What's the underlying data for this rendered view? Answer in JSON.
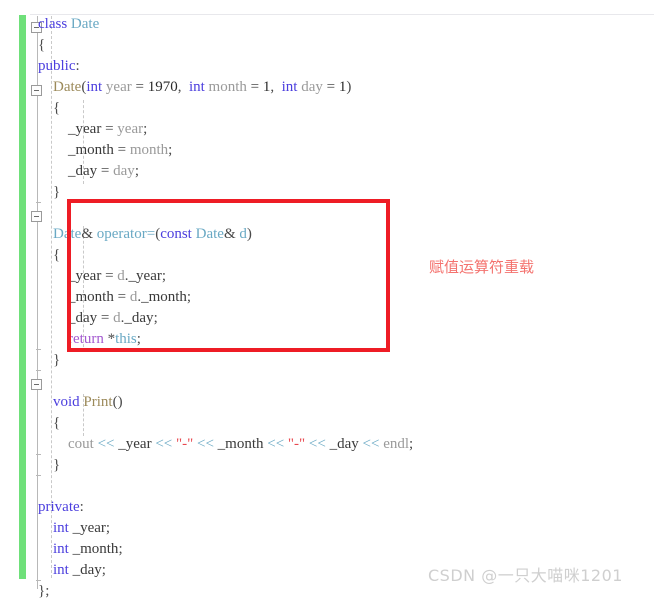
{
  "editor": {
    "language": "cpp",
    "gutter": {
      "change_bar_color": "#6fe07a",
      "fold_markers": [
        "collapse-class",
        "collapse-constructor",
        "collapse-operator",
        "collapse-print"
      ]
    },
    "theme": {
      "background": "#ffffff",
      "keyword_color": "#4b3ede",
      "type_color": "#6aa9c4",
      "function_color": "#9c8a5a",
      "identifier_color": "#3a3a3a",
      "parameter_color": "#9a9a9a",
      "string_color": "#e8484f",
      "return_color": "#a45ad0",
      "operator_color": "#6aa9c4"
    },
    "code_lines": [
      {
        "id": 1,
        "indent": 0,
        "tokens": [
          {
            "t": "class",
            "c": "kw"
          },
          {
            "t": " ",
            "c": "punct"
          },
          {
            "t": "Date",
            "c": "type"
          }
        ]
      },
      {
        "id": 2,
        "indent": 0,
        "tokens": [
          {
            "t": "{",
            "c": "punct"
          }
        ]
      },
      {
        "id": 3,
        "indent": 0,
        "tokens": [
          {
            "t": "public",
            "c": "kw"
          },
          {
            "t": ":",
            "c": "punct"
          }
        ]
      },
      {
        "id": 4,
        "indent": 1,
        "tokens": [
          {
            "t": "Date",
            "c": "fn"
          },
          {
            "t": "(",
            "c": "punct"
          },
          {
            "t": "int",
            "c": "kw"
          },
          {
            "t": " ",
            "c": "punct"
          },
          {
            "t": "year",
            "c": "param"
          },
          {
            "t": " = ",
            "c": "punct"
          },
          {
            "t": "1970",
            "c": "num"
          },
          {
            "t": ",  ",
            "c": "punct"
          },
          {
            "t": "int",
            "c": "kw"
          },
          {
            "t": " ",
            "c": "punct"
          },
          {
            "t": "month",
            "c": "param"
          },
          {
            "t": " = ",
            "c": "punct"
          },
          {
            "t": "1",
            "c": "num"
          },
          {
            "t": ",  ",
            "c": "punct"
          },
          {
            "t": "int",
            "c": "kw"
          },
          {
            "t": " ",
            "c": "punct"
          },
          {
            "t": "day",
            "c": "param"
          },
          {
            "t": " = ",
            "c": "punct"
          },
          {
            "t": "1",
            "c": "num"
          },
          {
            "t": ")",
            "c": "punct"
          }
        ]
      },
      {
        "id": 5,
        "indent": 1,
        "tokens": [
          {
            "t": "{",
            "c": "punct"
          }
        ]
      },
      {
        "id": 6,
        "indent": 2,
        "tokens": [
          {
            "t": "_year",
            "c": "ident"
          },
          {
            "t": " = ",
            "c": "punct"
          },
          {
            "t": "year",
            "c": "param"
          },
          {
            "t": ";",
            "c": "punct"
          }
        ]
      },
      {
        "id": 7,
        "indent": 2,
        "tokens": [
          {
            "t": "_month",
            "c": "ident"
          },
          {
            "t": " = ",
            "c": "punct"
          },
          {
            "t": "month",
            "c": "param"
          },
          {
            "t": ";",
            "c": "punct"
          }
        ]
      },
      {
        "id": 8,
        "indent": 2,
        "tokens": [
          {
            "t": "_day",
            "c": "ident"
          },
          {
            "t": " = ",
            "c": "punct"
          },
          {
            "t": "day",
            "c": "param"
          },
          {
            "t": ";",
            "c": "punct"
          }
        ]
      },
      {
        "id": 9,
        "indent": 1,
        "tokens": [
          {
            "t": "}",
            "c": "punct"
          }
        ]
      },
      {
        "id": 10,
        "indent": 0,
        "tokens": [
          {
            "t": "",
            "c": "punct"
          }
        ]
      },
      {
        "id": 11,
        "indent": 1,
        "tokens": [
          {
            "t": "Date",
            "c": "type"
          },
          {
            "t": "& ",
            "c": "punct"
          },
          {
            "t": "operator=",
            "c": "type"
          },
          {
            "t": "(",
            "c": "punct"
          },
          {
            "t": "const",
            "c": "kw"
          },
          {
            "t": " ",
            "c": "punct"
          },
          {
            "t": "Date",
            "c": "type"
          },
          {
            "t": "& ",
            "c": "punct"
          },
          {
            "t": "d",
            "c": "type"
          },
          {
            "t": ")",
            "c": "punct"
          }
        ]
      },
      {
        "id": 12,
        "indent": 1,
        "tokens": [
          {
            "t": "{",
            "c": "punct"
          }
        ]
      },
      {
        "id": 13,
        "indent": 2,
        "tokens": [
          {
            "t": "_year",
            "c": "ident"
          },
          {
            "t": " = ",
            "c": "punct"
          },
          {
            "t": "d",
            "c": "param"
          },
          {
            "t": ".",
            "c": "punct"
          },
          {
            "t": "_year",
            "c": "ident"
          },
          {
            "t": ";",
            "c": "punct"
          }
        ]
      },
      {
        "id": 14,
        "indent": 2,
        "tokens": [
          {
            "t": "_month",
            "c": "ident"
          },
          {
            "t": " = ",
            "c": "punct"
          },
          {
            "t": "d",
            "c": "param"
          },
          {
            "t": ".",
            "c": "punct"
          },
          {
            "t": "_month",
            "c": "ident"
          },
          {
            "t": ";",
            "c": "punct"
          }
        ]
      },
      {
        "id": 15,
        "indent": 2,
        "tokens": [
          {
            "t": "_day",
            "c": "ident"
          },
          {
            "t": " = ",
            "c": "punct"
          },
          {
            "t": "d",
            "c": "param"
          },
          {
            "t": ".",
            "c": "punct"
          },
          {
            "t": "_day",
            "c": "ident"
          },
          {
            "t": ";",
            "c": "punct"
          }
        ]
      },
      {
        "id": 16,
        "indent": 2,
        "tokens": [
          {
            "t": "return",
            "c": "ret"
          },
          {
            "t": " *",
            "c": "punct"
          },
          {
            "t": "this",
            "c": "type"
          },
          {
            "t": ";",
            "c": "punct"
          }
        ]
      },
      {
        "id": 17,
        "indent": 1,
        "tokens": [
          {
            "t": "}",
            "c": "punct"
          }
        ]
      },
      {
        "id": 18,
        "indent": 0,
        "tokens": [
          {
            "t": "",
            "c": "punct"
          }
        ]
      },
      {
        "id": 19,
        "indent": 1,
        "tokens": [
          {
            "t": "void",
            "c": "kw"
          },
          {
            "t": " ",
            "c": "punct"
          },
          {
            "t": "Print",
            "c": "fn"
          },
          {
            "t": "()",
            "c": "punct"
          }
        ]
      },
      {
        "id": 20,
        "indent": 1,
        "tokens": [
          {
            "t": "{",
            "c": "punct"
          }
        ]
      },
      {
        "id": 21,
        "indent": 2,
        "tokens": [
          {
            "t": "cout",
            "c": "param"
          },
          {
            "t": " ",
            "c": "punct"
          },
          {
            "t": "<<",
            "c": "op"
          },
          {
            "t": " ",
            "c": "punct"
          },
          {
            "t": "_year",
            "c": "ident"
          },
          {
            "t": " ",
            "c": "punct"
          },
          {
            "t": "<<",
            "c": "op"
          },
          {
            "t": " ",
            "c": "punct"
          },
          {
            "t": "\"-\"",
            "c": "str"
          },
          {
            "t": " ",
            "c": "punct"
          },
          {
            "t": "<<",
            "c": "op"
          },
          {
            "t": " ",
            "c": "punct"
          },
          {
            "t": "_month",
            "c": "ident"
          },
          {
            "t": " ",
            "c": "punct"
          },
          {
            "t": "<<",
            "c": "op"
          },
          {
            "t": " ",
            "c": "punct"
          },
          {
            "t": "\"-\"",
            "c": "str"
          },
          {
            "t": " ",
            "c": "punct"
          },
          {
            "t": "<<",
            "c": "op"
          },
          {
            "t": " ",
            "c": "punct"
          },
          {
            "t": "_day",
            "c": "ident"
          },
          {
            "t": " ",
            "c": "punct"
          },
          {
            "t": "<<",
            "c": "op"
          },
          {
            "t": " ",
            "c": "punct"
          },
          {
            "t": "endl",
            "c": "param"
          },
          {
            "t": ";",
            "c": "punct"
          }
        ]
      },
      {
        "id": 22,
        "indent": 1,
        "tokens": [
          {
            "t": "}",
            "c": "punct"
          }
        ]
      },
      {
        "id": 23,
        "indent": 0,
        "tokens": [
          {
            "t": "",
            "c": "punct"
          }
        ]
      },
      {
        "id": 24,
        "indent": 0,
        "tokens": [
          {
            "t": "private",
            "c": "kw"
          },
          {
            "t": ":",
            "c": "punct"
          }
        ]
      },
      {
        "id": 25,
        "indent": 1,
        "tokens": [
          {
            "t": "int",
            "c": "kw"
          },
          {
            "t": " ",
            "c": "punct"
          },
          {
            "t": "_year",
            "c": "ident"
          },
          {
            "t": ";",
            "c": "punct"
          }
        ]
      },
      {
        "id": 26,
        "indent": 1,
        "tokens": [
          {
            "t": "int",
            "c": "kw"
          },
          {
            "t": " ",
            "c": "punct"
          },
          {
            "t": "_month",
            "c": "ident"
          },
          {
            "t": ";",
            "c": "punct"
          }
        ]
      },
      {
        "id": 27,
        "indent": 1,
        "tokens": [
          {
            "t": "int",
            "c": "kw"
          },
          {
            "t": " ",
            "c": "punct"
          },
          {
            "t": "_day",
            "c": "ident"
          },
          {
            "t": ";",
            "c": "punct"
          }
        ]
      },
      {
        "id": 28,
        "indent": 0,
        "tokens": [
          {
            "t": "};",
            "c": "punct"
          }
        ]
      }
    ]
  },
  "annotation": {
    "text": "赋值运算符重载",
    "color": "#f4736f"
  },
  "highlight_box": {
    "color": "#ee1c25",
    "covers": "operator= assignment overload block"
  },
  "watermark": {
    "text": "CSDN @一只大喵咪1201",
    "color": "#cfcfcf"
  }
}
